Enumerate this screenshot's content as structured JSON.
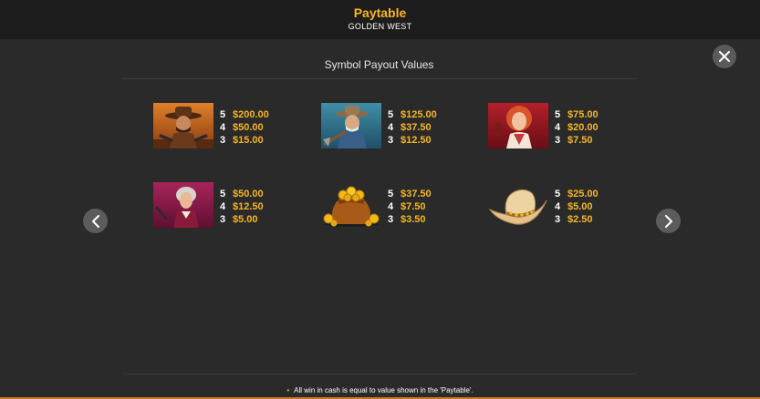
{
  "header": {
    "title": "Paytable",
    "subtitle": "GOLDEN WEST"
  },
  "section_title": "Symbol Payout Values",
  "symbols": [
    {
      "name": "cowboy-gunslinger",
      "pays": [
        {
          "count": "5",
          "value": "$200.00"
        },
        {
          "count": "4",
          "value": "$50.00"
        },
        {
          "count": "3",
          "value": "$15.00"
        }
      ]
    },
    {
      "name": "old-prospector",
      "pays": [
        {
          "count": "5",
          "value": "$125.00"
        },
        {
          "count": "4",
          "value": "$37.50"
        },
        {
          "count": "3",
          "value": "$12.50"
        }
      ]
    },
    {
      "name": "red-haired-woman",
      "pays": [
        {
          "count": "5",
          "value": "$75.00"
        },
        {
          "count": "4",
          "value": "$20.00"
        },
        {
          "count": "3",
          "value": "$7.50"
        }
      ]
    },
    {
      "name": "old-lady",
      "pays": [
        {
          "count": "5",
          "value": "$50.00"
        },
        {
          "count": "4",
          "value": "$12.50"
        },
        {
          "count": "3",
          "value": "$5.00"
        }
      ]
    },
    {
      "name": "gold-sack",
      "pays": [
        {
          "count": "5",
          "value": "$37.50"
        },
        {
          "count": "4",
          "value": "$7.50"
        },
        {
          "count": "3",
          "value": "$3.50"
        }
      ]
    },
    {
      "name": "cowboy-hat",
      "pays": [
        {
          "count": "5",
          "value": "$25.00"
        },
        {
          "count": "4",
          "value": "$5.00"
        },
        {
          "count": "3",
          "value": "$2.50"
        }
      ]
    }
  ],
  "footer_note": "All win in cash is equal to value shown in the 'Paytable'.",
  "colors": {
    "accent": "#f5b623",
    "background": "#2a2a2a",
    "header": "#1d1d1d"
  }
}
